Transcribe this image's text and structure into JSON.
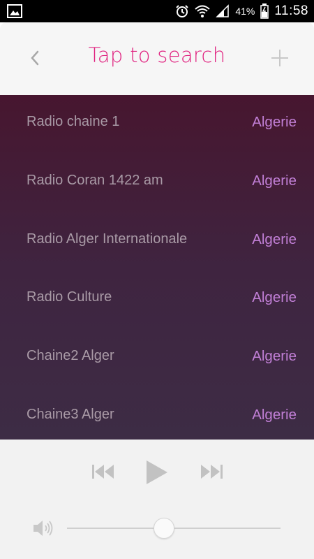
{
  "status_bar": {
    "battery_percent": "41%",
    "time": "11:58",
    "icons": [
      "gallery-icon",
      "alarm-icon",
      "wifi-icon",
      "signal-icon",
      "battery-icon"
    ]
  },
  "header": {
    "title": "Tap to search",
    "back_icon": "chevron-left-icon",
    "add_icon": "plus-icon"
  },
  "stations": [
    {
      "name": "Radio chaine 1",
      "country": "Algerie"
    },
    {
      "name": "Radio Coran 1422 am",
      "country": "Algerie"
    },
    {
      "name": "Radio Alger Internationale",
      "country": "Algerie"
    },
    {
      "name": "Radio Culture",
      "country": "Algerie"
    },
    {
      "name": "Chaine2 Alger",
      "country": "Algerie"
    },
    {
      "name": "Chaine3 Alger",
      "country": "Algerie"
    }
  ],
  "player": {
    "controls": [
      "skip-previous-icon",
      "play-icon",
      "skip-next-icon"
    ],
    "volume_level": 0.45
  },
  "colors": {
    "accent": "#e0217f",
    "country_text": "#c17fd6",
    "station_text": "#a99aa6",
    "list_bg_top": "#47162f",
    "list_bg_bottom": "#3d2c45"
  }
}
